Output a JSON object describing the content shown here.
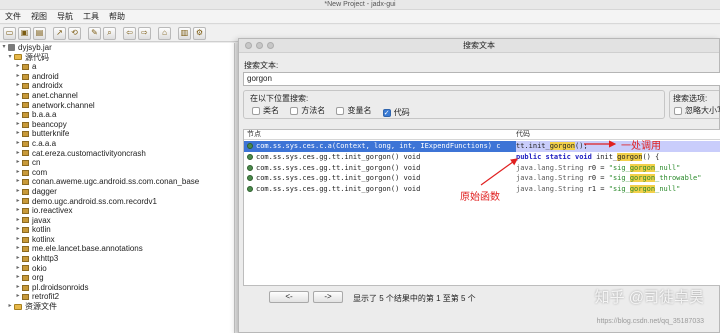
{
  "window": {
    "title": "*New Project - jadx-gui"
  },
  "menu": [
    "文件",
    "视图",
    "导航",
    "工具",
    "帮助"
  ],
  "toolbar": {
    "icons": [
      "open-folder-icon",
      "save-icon",
      "save-all-icon",
      "export-icon",
      "sync-icon",
      "search-icon",
      "find-class-icon",
      "back-icon",
      "forward-icon",
      "deobfuscation-icon",
      "log-icon",
      "settings-icon"
    ]
  },
  "tree": {
    "root": "dyjsyb.jar",
    "source_folder": "源代码",
    "packages": [
      "a",
      "android",
      "androidx",
      "anet.channel",
      "anetwork.channel",
      "b.a.a.a",
      "beancopy",
      "butterknife",
      "c.a.a.a",
      "cat.ereza.customactivityoncrash",
      "cn",
      "com",
      "conan.aweme.ugc.android.ss.com.conan_base",
      "dagger",
      "demo.ugc.android.ss.com.recordv1",
      "io.reactivex",
      "javax",
      "kotlin",
      "kotlinx",
      "me.ele.lancet.base.annotations",
      "okhttp3",
      "okio",
      "org",
      "pl.droidsonroids",
      "retrofit2"
    ],
    "resources_folder": "资源文件"
  },
  "dialog": {
    "title": "搜索文本",
    "search_label": "搜索文本:",
    "search_value": "gorgon",
    "search_in_label": "在以下位置搜索:",
    "options": [
      {
        "label": "类名",
        "checked": false
      },
      {
        "label": "方法名",
        "checked": false
      },
      {
        "label": "变量名",
        "checked": false
      },
      {
        "label": "代码",
        "checked": true
      }
    ],
    "search_options_label": "搜索选项:",
    "ignore_case_label": "忽略大小写",
    "columns": {
      "node": "节点",
      "code": "代码"
    },
    "results": [
      {
        "node": "com.ss.sys.ces.c.a(Context, long, int, IExpendFunctions) c",
        "selected": true
      },
      {
        "node": "com.ss.sys.ces.gg.tt.init_gorgon() void",
        "selected": false
      },
      {
        "node": "com.ss.sys.ces.gg.tt.init_gorgon() void",
        "selected": false
      },
      {
        "node": "com.ss.sys.ces.gg.tt.init_gorgon() void",
        "selected": false
      },
      {
        "node": "com.ss.sys.ces.gg.tt.init_gorgon() void",
        "selected": false
      }
    ],
    "code_lines": [
      {
        "pre": "tt.init_",
        "hl": "gorgon",
        "post": "();"
      },
      {
        "kw": "public static void",
        "pre": " init_",
        "hl": "gorgon",
        "post": "() {"
      },
      {
        "type": "java.lang.String",
        "pre": " r0 = ",
        "str_pre": "\"sig_",
        "hl": "gorgon",
        "str_post": "_null\""
      },
      {
        "type": "java.lang.String",
        "pre": " r0 = ",
        "str_pre": "\"sig_",
        "hl": "gorgon",
        "str_post": "_throwable\""
      },
      {
        "type": "java.lang.String",
        "pre": " r1 = ",
        "str_pre": "\"sig_",
        "hl": "gorgon",
        "str_post": "_null\""
      }
    ],
    "annotations": {
      "call_site": "一处调用",
      "original_function": "原始函数"
    },
    "prev_button": "<-",
    "next_button": "->",
    "status": "显示了 5 个结果中的第 1 至第 5 个"
  },
  "watermark": {
    "line1": "知乎 @司徒卓昊",
    "line2": "https://blog.csdn.net/qq_35187033"
  }
}
